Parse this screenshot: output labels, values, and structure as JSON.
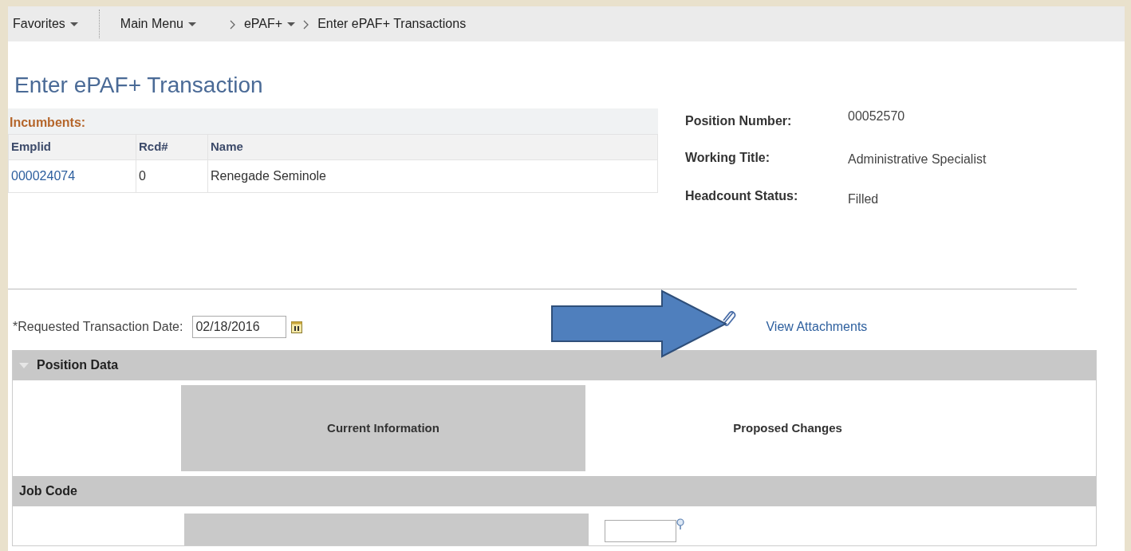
{
  "breadcrumbs": [
    {
      "label": "Favorites",
      "kind": "menu"
    },
    {
      "label": "Main Menu",
      "kind": "menu"
    },
    {
      "label": "ePAF+",
      "kind": "menu"
    },
    {
      "label": "Enter ePAF+ Transactions",
      "kind": "page"
    }
  ],
  "page_title": "Enter ePAF+ Transaction",
  "incumbents": {
    "title": "Incumbents:",
    "columns": [
      "Emplid",
      "Rcd#",
      "Name"
    ],
    "rows": [
      [
        "000024074",
        "0",
        "Renegade Seminole"
      ]
    ]
  },
  "position_info": [
    {
      "label": "Position Number:",
      "value": "00052570"
    },
    {
      "label": "Working Title:",
      "value": "Administrative Specialist"
    },
    {
      "label": "Headcount Status:",
      "value": "Filled"
    }
  ],
  "requested_date": {
    "label": "*Requested Transaction Date:",
    "value": "02/18/2016"
  },
  "attachments_link": "View Attachments",
  "position_data": {
    "title": "Position Data",
    "expanded": true,
    "columns": [
      "Current Information",
      "Proposed Changes"
    ],
    "sections": [
      {
        "title": "Job Code"
      }
    ]
  }
}
